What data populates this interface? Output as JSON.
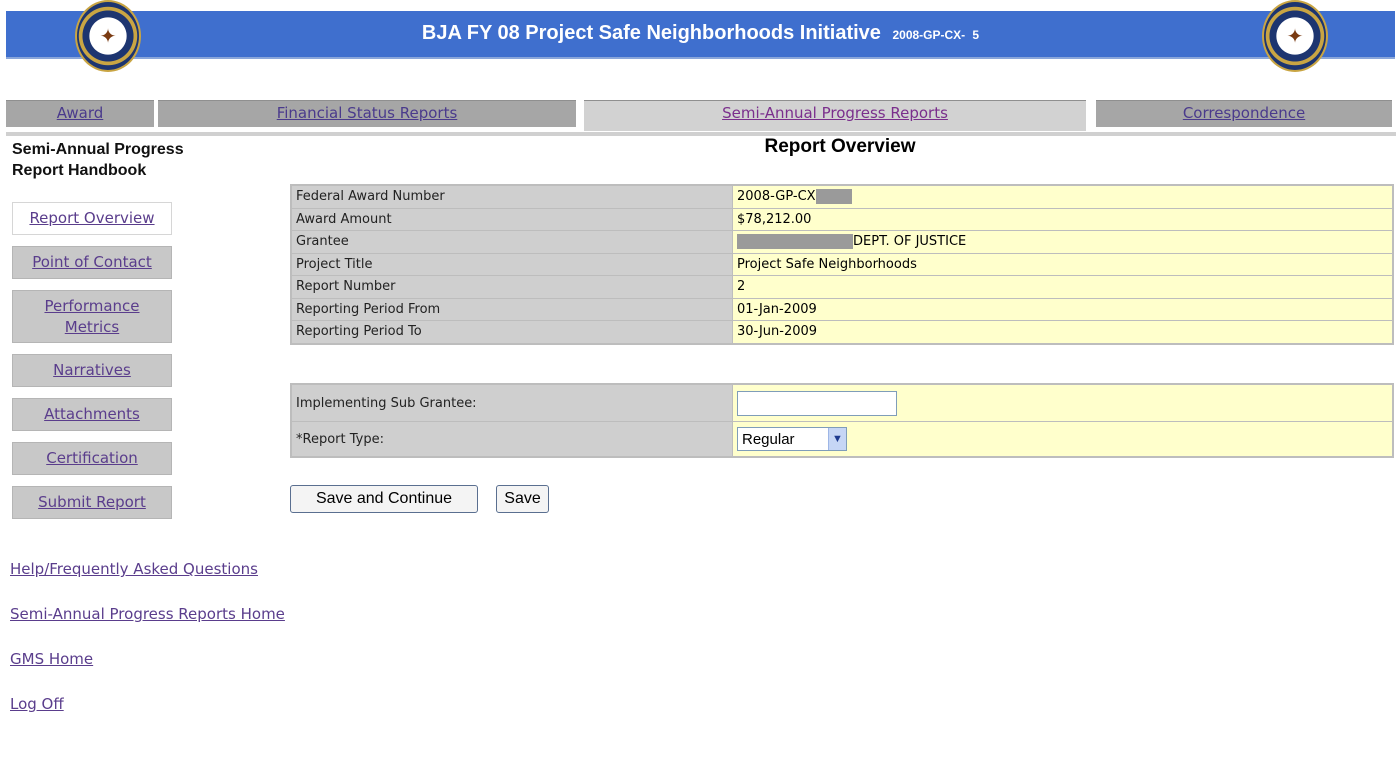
{
  "header": {
    "title": "BJA FY 08 Project Safe Neighborhoods Initiative",
    "grant_number": "2008-GP-CX-   5"
  },
  "tabs": [
    {
      "label": "Award",
      "active": false
    },
    {
      "label": "Financial Status Reports",
      "active": false
    },
    {
      "label": "Semi-Annual Progress Reports",
      "active": true
    },
    {
      "label": "Correspondence",
      "active": false
    }
  ],
  "sidebar": {
    "handbook_line1": "Semi-Annual Progress",
    "handbook_line2": "Report Handbook",
    "items": [
      {
        "label": "Report Overview",
        "active": true
      },
      {
        "label": "Point of Contact"
      },
      {
        "label_line1": "Performance",
        "label_line2": "Metrics"
      },
      {
        "label": "Narratives"
      },
      {
        "label": "Attachments"
      },
      {
        "label": "Certification"
      },
      {
        "label": "Submit Report"
      }
    ],
    "links": [
      "Help/Frequently Asked Questions",
      "Semi-Annual Progress Reports Home",
      "GMS Home",
      "Log Off"
    ]
  },
  "main": {
    "heading": "Report Overview",
    "overview": [
      {
        "label": "Federal Award Number",
        "value": "2008-GP-CX"
      },
      {
        "label": "Award Amount",
        "value": "$78,212.00"
      },
      {
        "label": "Grantee",
        "value": "DEPT. OF JUSTICE"
      },
      {
        "label": "Project Title",
        "value": "Project Safe Neighborhoods"
      },
      {
        "label": "Report Number",
        "value": "2"
      },
      {
        "label": "Reporting Period From",
        "value": "01-Jan-2009"
      },
      {
        "label": "Reporting Period To",
        "value": "30-Jun-2009"
      }
    ],
    "form": {
      "sub_grantee_label": "Implementing Sub Grantee:",
      "sub_grantee_value": "",
      "report_type_label": "*Report Type:",
      "report_type_value": "Regular"
    },
    "buttons": {
      "save_continue": "Save and Continue",
      "save": "Save"
    }
  },
  "colors": {
    "banner": "#3f6fce",
    "tab_inactive": "#a6a6a6",
    "tab_active": "#d2d2d2",
    "label_cell": "#cfcfcf",
    "value_cell": "#ffffcc",
    "link": "#5a3d8c"
  },
  "icons": {
    "left_seal": "doj-seal-icon",
    "right_seal": "office-of-justice-programs-seal-icon",
    "dropdown": "chevron-down-icon"
  }
}
